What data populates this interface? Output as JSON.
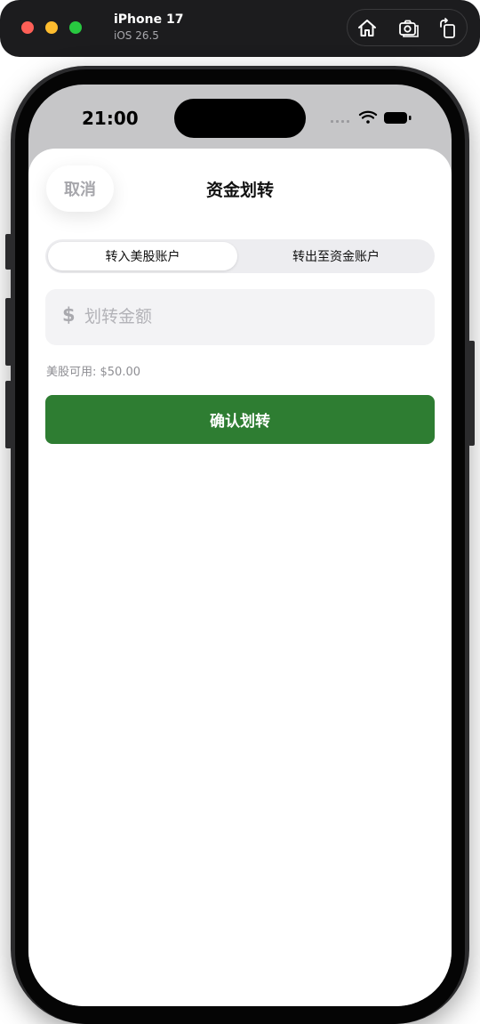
{
  "simulator": {
    "device_name": "iPhone 17",
    "os_version": "iOS 26.5"
  },
  "status_bar": {
    "time": "21:00"
  },
  "sheet": {
    "cancel_label": "取消",
    "title": "资金划转",
    "tabs": [
      {
        "label": "转入美股账户",
        "selected": true
      },
      {
        "label": "转出至资金账户",
        "selected": false
      }
    ],
    "amount_field": {
      "currency_symbol": "$",
      "placeholder": "划转金额",
      "value": ""
    },
    "available_text": "美股可用: $50.00",
    "confirm_label": "确认划转"
  },
  "colors": {
    "accent_green": "#2e7d32",
    "placeholder_gray": "#b3b3b8",
    "toolbar_bg": "#1c1c1e"
  }
}
